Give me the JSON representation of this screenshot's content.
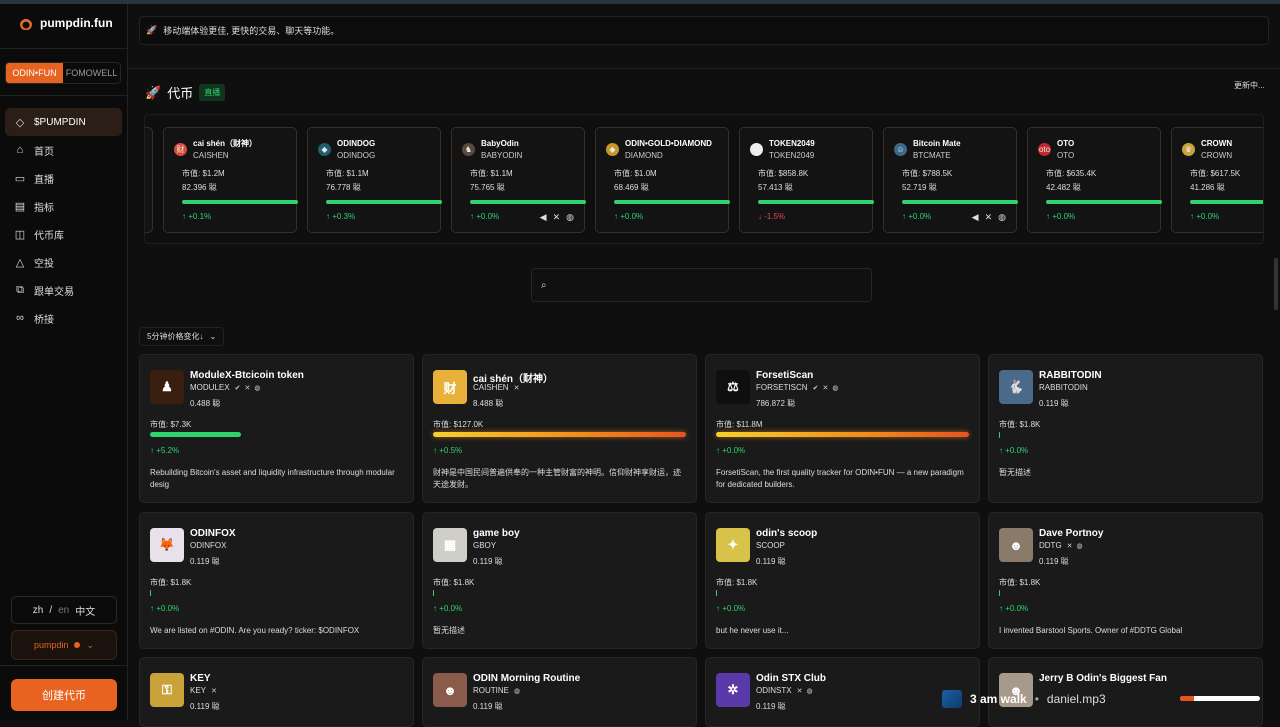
{
  "app": {
    "name": "pumpdin.fun"
  },
  "sidebar": {
    "segments": [
      {
        "label": "ODIN•FUN",
        "active": true
      },
      {
        "label": "FOMOWELL",
        "active": false
      }
    ],
    "items": [
      {
        "label": "$PUMPDIN",
        "icon": "diamond-icon",
        "active": true
      },
      {
        "label": "首页",
        "icon": "home-icon"
      },
      {
        "label": "直播",
        "icon": "video-icon"
      },
      {
        "label": "指标",
        "icon": "chart-icon"
      },
      {
        "label": "代币库",
        "icon": "vault-icon"
      },
      {
        "label": "空投",
        "icon": "airdrop-icon"
      },
      {
        "label": "跟单交易",
        "icon": "copy-icon"
      },
      {
        "label": "桥接",
        "icon": "link-icon"
      }
    ],
    "lang": {
      "zh": "zh",
      "slash": "/",
      "en": "en",
      "current": "中文"
    },
    "wallet": "pumpdin",
    "create": "创建代币"
  },
  "banner": {
    "text": "移动端体验更佳, 更快的交易、聊天等功能。"
  },
  "section": {
    "title": "代币",
    "live": "直播",
    "updating": "更新中..."
  },
  "ticker": [
    {
      "name": "cai shén（财神）",
      "symbol": "CAISHEN",
      "cap": "市值: $1.2M",
      "price": "82.396 聪",
      "change": "↑ +0.1%",
      "dir": "up",
      "avatar": "#d94b3a",
      "glyph": "财",
      "socials": []
    },
    {
      "name": "ODINDOG",
      "symbol": "ODINDOG",
      "cap": "市值: $1.1M",
      "price": "76.778 聪",
      "change": "↑ +0.3%",
      "dir": "up",
      "avatar": "#1f5e6a",
      "glyph": "◆",
      "socials": []
    },
    {
      "name": "BabyOdin",
      "symbol": "BABYODIN",
      "cap": "市值: $1.1M",
      "price": "75.765 聪",
      "change": "↑ +0.0%",
      "dir": "up",
      "avatar": "#5a4a3a",
      "glyph": "♞",
      "socials": [
        "◀",
        "✕",
        "◍"
      ]
    },
    {
      "name": "ODIN•GOLD•DIAMOND",
      "symbol": "DIAMOND",
      "cap": "市值: $1.0M",
      "price": "68.469 聪",
      "change": "↑ +0.0%",
      "dir": "up",
      "avatar": "#c9962a",
      "glyph": "◆",
      "socials": []
    },
    {
      "name": "TOKEN2049",
      "symbol": "TOKEN2049",
      "cap": "市值: $858.8K",
      "price": "57.413 聪",
      "change": "↓ -1.5%",
      "dir": "down",
      "avatar": "#eeeeee",
      "glyph": "",
      "socials": []
    },
    {
      "name": "Bitcoin Mate",
      "symbol": "BTCMATE",
      "cap": "市值: $788.5K",
      "price": "52.719 聪",
      "change": "↑ +0.0%",
      "dir": "up",
      "avatar": "#3a6a8a",
      "glyph": "☺",
      "socials": [
        "◀",
        "✕",
        "◍"
      ]
    },
    {
      "name": "OTO",
      "symbol": "OTO",
      "cap": "市值: $635.4K",
      "price": "42.482 聪",
      "change": "↑ +0.0%",
      "dir": "up",
      "avatar": "#c02a2a",
      "glyph": "oto",
      "socials": []
    },
    {
      "name": "CROWN",
      "symbol": "CROWN",
      "cap": "市值: $617.5K",
      "price": "41.286 聪",
      "change": "↑ +0.0%",
      "dir": "up",
      "avatar": "#c9a23a",
      "glyph": "♛",
      "socials": []
    }
  ],
  "search": {
    "placeholder": ""
  },
  "sort": {
    "label": "5分钟价格变化↓"
  },
  "cards": [
    {
      "title": "ModuleX-Btcicoin token",
      "symbol": "MODULEX",
      "icons": [
        "✔",
        "✕",
        "◍"
      ],
      "price": "0.488 聪",
      "cap": "市值: $7.3K",
      "bar": "green",
      "fill": 0.36,
      "change": "↑ +5.2%",
      "desc": "Rebuilding Bitcoin's asset and liquidity infrastructure through modular desig",
      "avatar": "#3a1e10",
      "glyph": "♟"
    },
    {
      "title": "cai shén（财神）",
      "symbol": "CAISHEN",
      "icons": [
        "✕"
      ],
      "price": "8.488 聪",
      "cap": "市值: $127.0K",
      "bar": "fire",
      "fill": 1,
      "change": "↑ +0.5%",
      "desc": "财神是中国民间普遍供奉的一种主管财富的神明。信仰财神享财运，迹天途发财。",
      "avatar": "#e8b23a",
      "glyph": "财"
    },
    {
      "title": "ForsetiScan",
      "symbol": "FORSETISCN",
      "icons": [
        "✔",
        "✕",
        "◍"
      ],
      "price": "786.872 聪",
      "cap": "市值: $11.8M",
      "bar": "fire",
      "fill": 1,
      "change": "↑ +0.0%",
      "desc": "ForsetiScan, the first quality tracker for ODIN•FUN — a new paradigm for dedicated builders.",
      "avatar": "#0f0f0f",
      "glyph": "⚖"
    },
    {
      "title": "RABBITODIN",
      "symbol": "RABBITODIN",
      "icons": [],
      "price": "0.119 聪",
      "cap": "市值: $1.8K",
      "bar": "tick",
      "fill": 0,
      "change": "↑ +0.0%",
      "desc": "暂无描述",
      "avatar": "#4a6a8a",
      "glyph": "🐇"
    },
    {
      "title": "ODINFOX",
      "symbol": "ODINFOX",
      "icons": [],
      "price": "0.119 聪",
      "cap": "市值: $1.8K",
      "bar": "tick",
      "fill": 0,
      "change": "↑ +0.0%",
      "desc": "We are listed on #ODIN. Are you ready? ticker: $ODINFOX",
      "avatar": "#e8e0ea",
      "glyph": "🦊"
    },
    {
      "title": "game boy",
      "symbol": "GBOY",
      "icons": [],
      "price": "0.119 聪",
      "cap": "市值: $1.8K",
      "bar": "tick",
      "fill": 0,
      "change": "↑ +0.0%",
      "desc": "暂无描述",
      "avatar": "#cfcfc8",
      "glyph": "▦"
    },
    {
      "title": "odin's scoop",
      "symbol": "SCOOP",
      "icons": [],
      "price": "0.119 聪",
      "cap": "市值: $1.8K",
      "bar": "tick",
      "fill": 0,
      "change": "↑ +0.0%",
      "desc": "but he never use it...",
      "avatar": "#d9c24a",
      "glyph": "✦"
    },
    {
      "title": "Dave Portnoy",
      "symbol": "DDTG",
      "icons": [
        "✕",
        "◍"
      ],
      "price": "0.119 聪",
      "cap": "市值: $1.8K",
      "bar": "tick",
      "fill": 0,
      "change": "↑ +0.0%",
      "desc": "I invented Barstool Sports. Owner of #DDTG Global",
      "avatar": "#8a7a6a",
      "glyph": "☻"
    },
    {
      "title": "KEY",
      "symbol": "KEY",
      "icons": [
        "✕"
      ],
      "price": "0.119 聪",
      "cap": "",
      "bar": "none",
      "fill": 0,
      "change": "",
      "desc": "",
      "avatar": "#c9a23a",
      "glyph": "⚿"
    },
    {
      "title": "ODIN Morning Routine",
      "symbol": "ROUTINE",
      "icons": [
        "◍"
      ],
      "price": "0.119 聪",
      "cap": "",
      "bar": "none",
      "fill": 0,
      "change": "",
      "desc": "",
      "avatar": "#8a5a4a",
      "glyph": "☻"
    },
    {
      "title": "Odin STX Club",
      "symbol": "ODINSTX",
      "icons": [
        "✕",
        "◍"
      ],
      "price": "0.119 聪",
      "cap": "",
      "bar": "none",
      "fill": 0,
      "change": "",
      "desc": "",
      "avatar": "#5a3aa8",
      "glyph": "✲"
    },
    {
      "title": "Jerry B Odin's Biggest Fan",
      "symbol": "",
      "icons": [],
      "price": "",
      "cap": "",
      "bar": "none",
      "fill": 0,
      "change": "",
      "desc": "",
      "avatar": "#a89a8a",
      "glyph": "☻"
    }
  ],
  "player": {
    "title": "3 am walk",
    "dot": "•",
    "file": "daniel.mp3",
    "progress": 0.18
  },
  "colors": {
    "accent": "#e8631f",
    "up": "#2ed36e",
    "down": "#e5484d"
  }
}
